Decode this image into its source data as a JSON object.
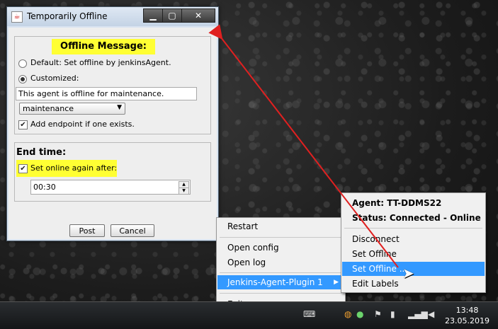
{
  "dialog": {
    "title": "Temporarily Offline",
    "offline_heading": "Offline Message:",
    "default_option": "Default: Set offline by jenkinsAgent.",
    "customized_option": "Customized:",
    "message_value": "This agent is offline for maintenance.",
    "reason_selected": "maintenance",
    "add_endpoint_label": "Add endpoint if one exists.",
    "end_time_heading": "End time:",
    "set_online_label": "Set online again after:",
    "time_value": "00:30",
    "post_label": "Post",
    "cancel_label": "Cancel",
    "default_checked": false,
    "customized_checked": true,
    "add_endpoint_checked": true,
    "set_online_checked": true
  },
  "tray_menu": {
    "items": [
      "Restart",
      "Open config",
      "Open log",
      "Jenkins-Agent-Plugin 1",
      "Exit"
    ]
  },
  "agent_menu": {
    "agent_label": "Agent: TT-DDMS22",
    "status_label": "Status: Connected - Online",
    "items": [
      "Disconnect",
      "Set Offline",
      "Set Offline ...",
      "Edit Labels"
    ]
  },
  "taskbar": {
    "time": "13:48",
    "date": "23.05.2019"
  },
  "colors": {
    "highlight": "#ffff33",
    "menu_selection": "#3399ff",
    "arrow": "#e02020"
  }
}
